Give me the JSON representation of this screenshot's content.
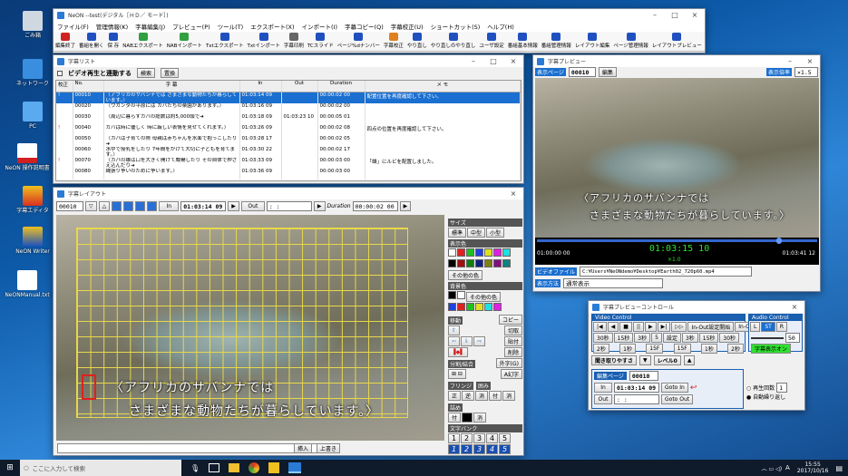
{
  "desktop": {
    "icons": [
      "ごみ箱",
      "ネットワーク",
      "PC",
      "NeON 操作説明書",
      "字幕エディタ",
      "NeON Writer",
      "NeONManual.txt"
    ]
  },
  "main": {
    "title": "NeON --test(デジタル［ＨＤ／ モード］)",
    "menu": [
      "ファイル(F)",
      "管理情報(K)",
      "字幕編集(J)",
      "プレビュー(P)",
      "ツール(T)",
      "エクスポート(X)",
      "インポート(I)",
      "字幕コピー(Q)",
      "字幕校正(U)",
      "ショートカット(S)",
      "ヘルプ(H)"
    ],
    "tools": [
      "編集終了",
      "番組を開く",
      "保 存",
      "NABエクスポート",
      "NABインポート",
      "Txtエクスポート",
      "Txtインポート",
      "字幕印刷",
      "TCスライド",
      "ページ%dナンバー",
      "字幕校正",
      "やり直し",
      "やり直しのやり直し",
      "ユーザ設定",
      "番組基本情報",
      "番組管理情報",
      "レイアウト編集",
      "ページ管理情報",
      "レイアウトプレビュー"
    ]
  },
  "list": {
    "title": "字幕リスト",
    "sync_label": "ビデオ再生と連動する",
    "search_btn": "検索",
    "replace_btn": "置換",
    "headers": [
      "校正",
      "No.",
      "字 幕",
      "In",
      "Out",
      "Duration",
      "メ モ"
    ],
    "rows": [
      {
        "no": "00010",
        "text": "〈アフリカのサバンナでは さまざまな動物たちが暮らしています。〉",
        "in": "01:03:14 09",
        "out": "",
        "dur": "00:00:02 00",
        "memo": "配置位置を再度確認して下さい。"
      },
      {
        "no": "00020",
        "text": "〈ウガンダの平原には カバたちの楽園があります。〉",
        "in": "01:03:16 09",
        "out": "",
        "dur": "00:00:02 00",
        "memo": ""
      },
      {
        "no": "00030",
        "text": "〈周辺に暮らすカバの総数は約5,000頭で➜",
        "in": "01:03:18 09",
        "out": "01:03:23 10",
        "dur": "00:00:05 01",
        "memo": ""
      },
      {
        "no": "00040",
        "text": "カバは時に優しく 時に厳しい表情を見せてくれます。〉",
        "in": "01:03:26 09",
        "out": "",
        "dur": "00:00:02 08",
        "memo": "四点の位置を再度確認して下さい。"
      },
      {
        "no": "00050",
        "text": "〈カバは子育ての際 母親は赤ちゃんを水面で抱っこしたり➜",
        "in": "01:03:28 17",
        "out": "",
        "dur": "00:00:02 05",
        "memo": ""
      },
      {
        "no": "00060",
        "text": "水中で授乳をしたり 7年間をかけて大切に子どもを育てます。〉",
        "in": "01:03:30 22",
        "out": "",
        "dur": "00:00:02 17",
        "memo": ""
      },
      {
        "no": "00070",
        "text": "〈カバの雄は口を大きく開けて威嚇したり その自体で押さえ込んだり➜",
        "in": "01:03:33 09",
        "out": "",
        "dur": "00:00:03 00",
        "memo": "「雄」にルビを配置しました。"
      },
      {
        "no": "00080",
        "text": "縄張り争いのために争います。〉",
        "in": "01:03:36 09",
        "out": "",
        "dur": "00:00:03 00",
        "memo": ""
      }
    ]
  },
  "layout": {
    "title": "字幕レイアウト",
    "page_no": "00010",
    "in_label": "In",
    "in_tc": "01:03:14 09",
    "out_label": "Out",
    "out_tc": " :  :  ",
    "dur_label": "Duration",
    "dur_tc": "00:00:02 00",
    "sub1": "〈アフリカのサバンナでは",
    "sub2": "さまざまな動物たちが暮らしています。〉",
    "insert_btn": "挿入",
    "overwrite_btn": "上書き",
    "panel": {
      "size": "サイズ",
      "std": "標準",
      "mid": "中型",
      "small": "小型",
      "color": "表示色",
      "other_color": "その他の色",
      "bg": "背景色",
      "bg_other": "その他の色",
      "move": "移動",
      "copy": "コピー",
      "cut": "切取",
      "paste": "貼付",
      "delete": "削除",
      "split": "分割/結合",
      "ext": "外字(G)",
      "ruby": "A幻字",
      "fringe": "フリンジ",
      "frame": "囲み",
      "tsume": "詰め",
      "fr_on": "付",
      "fr_off": "消",
      "tz_on": "付",
      "tz_off": "消",
      "horiz": "正",
      "vert": "逆",
      "bank": "文字バンク",
      "bank_nums": [
        "1",
        "2",
        "3",
        "4",
        "5"
      ]
    }
  },
  "preview": {
    "title": "字幕プレビュー",
    "page_label": "表示ページ",
    "page_no": "00010",
    "edit_btn": "編集",
    "zoom_label": "表示倍率",
    "zoom_val": "×1.5",
    "sub1": "〈アフリカのサバンナでは",
    "sub2": "さまざまな動物たちが暮らしています。〉",
    "start_tc": "01:00:00 00",
    "cur_tc": "01:03:15 10",
    "speed": "×1.0",
    "end_tc": "01:03:41 12",
    "file_label": "ビデオファイル",
    "file_path": "C:¥Users¥NeONdemo¥Desktop¥Earth02_720p60.mp4",
    "mode_label": "表示方法",
    "mode_val": "通常表示"
  },
  "control": {
    "title": "字幕プレビューコントロール",
    "video_label": "Video Control",
    "audio_label": "Audio Control",
    "inout_set": "In-Out設定開始",
    "inout_f4": "In-Out (F4)",
    "rows1": [
      "30秒",
      "15秒",
      "3秒",
      "5",
      "設定",
      "3秒",
      "15秒",
      "30秒"
    ],
    "rows2": [
      "2秒",
      "1秒",
      "15F",
      "15F",
      "1秒",
      "2秒"
    ],
    "lr": [
      "L",
      "ST",
      "R"
    ],
    "vol": "50",
    "sub_btn": "字幕表示オン",
    "listen_label": "聞き取りやすさ",
    "level": "レベル0",
    "edit_page_label": "編集ページ",
    "edit_page": "00010",
    "in_label": "In",
    "in_tc": "01:03:14 09",
    "goto_in": "Goto In",
    "out_label": "Out",
    "out_tc": " :  :  ",
    "goto_out": "Goto Out",
    "repeat_label": "再生回数",
    "repeat_val": "1",
    "auto_label": "自動繰り返し"
  },
  "taskbar": {
    "search": "ここに入力して検索",
    "time": "15:55",
    "date": "2017/10/16",
    "ime": "A"
  }
}
